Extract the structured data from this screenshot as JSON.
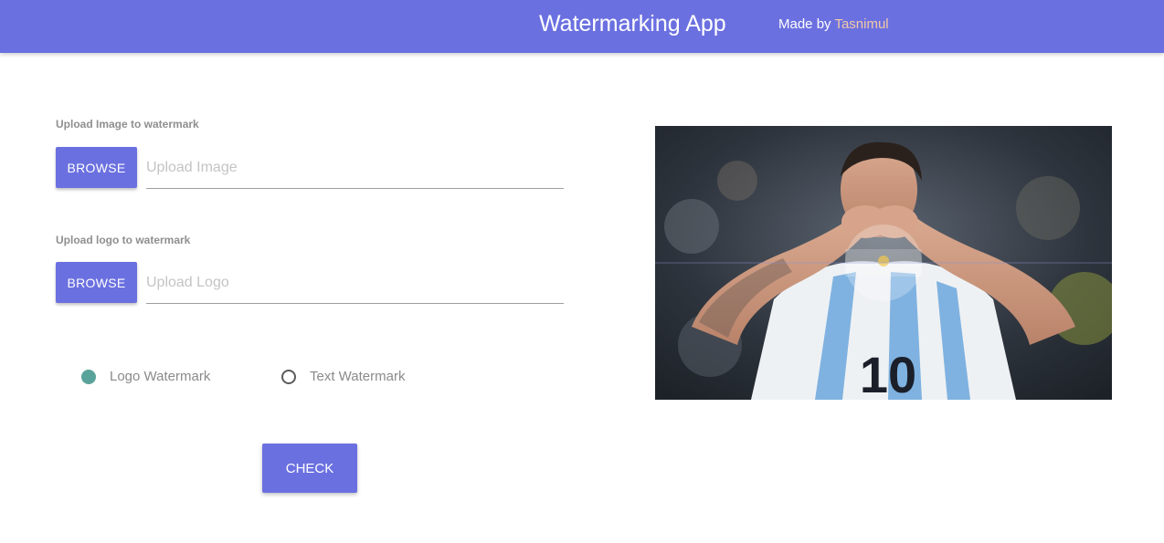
{
  "header": {
    "title": "Watermarking App",
    "credit_prefix": "Made by",
    "credit_author": "Tasnimul"
  },
  "image_upload": {
    "label": "Upload Image to watermark",
    "button_label": "BROWSE",
    "placeholder": "Upload Image"
  },
  "logo_upload": {
    "label": "Upload logo to watermark",
    "button_label": "BROWSE",
    "placeholder": "Upload Logo"
  },
  "watermark_type": {
    "options": [
      {
        "label": "Logo Watermark",
        "checked": true
      },
      {
        "label": "Text Watermark",
        "checked": false
      }
    ]
  },
  "actions": {
    "check_label": "CHECK"
  },
  "colors": {
    "primary": "#6b70e0",
    "radio_checked": "#5aa39a",
    "credit_author": "#f2c9a8"
  }
}
